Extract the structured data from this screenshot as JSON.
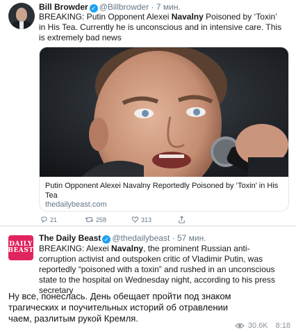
{
  "tweet1": {
    "author_name": "Bill Browder",
    "handle_time": "@Billbrowder · 7 мин.",
    "text": "BREAKING: Putin Opponent Alexei Navalny Poisoned by ‘Toxin’ in His Tea. Currently he is unconscious and in intensive care. This is extremely bad news",
    "card": {
      "title": "Putin Opponent Alexei Navalny Reportedly Poisoned by ‘Toxin’ in His Tea",
      "domain": "thedailybeast.com"
    },
    "actions": {
      "replies": "21",
      "retweets": "258",
      "likes": "313"
    }
  },
  "tweet2": {
    "author_name": "The Daily Beast",
    "handle_time": "@thedailybeast · 57 мин.",
    "avatar_text_top": "DAILY",
    "avatar_text_bottom": "BEAST",
    "text": "BREAKING: Alexei Navalny, the prominent Russian anti-corruption activist and outspoken critic of Vladimir Putin, was reportedly “poisoned with a toxin” and rushed in an unconscious state to the hospital on Wednesday night, according to his press secretary"
  },
  "post": {
    "message": "Ну все, понеслась. День обещает пройти под знаком трагических и поучительных историй об отравлении чаем, разлитым рукой Кремля.",
    "views": "30.6K",
    "time": "8:18"
  },
  "colors": {
    "verified": "#1da1f2",
    "secondary_text": "#657786",
    "daily_beast_red": "#e0245e"
  }
}
